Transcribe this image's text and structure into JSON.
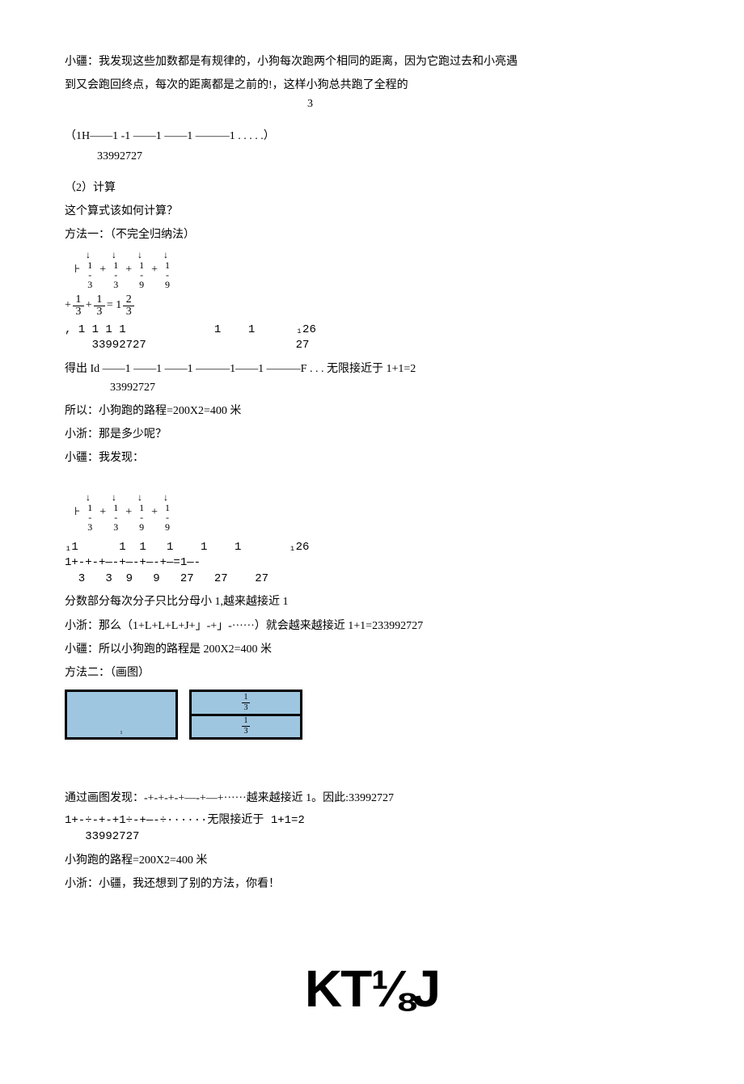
{
  "p1": "小疆：我发现这些加数都是有规律的，小狗每次跑两个相同的距离，因为它跑过去和小亮遇",
  "p2": "到又会跑回终点，每次的距离都是之前的!，这样小狗总共跑了全程的",
  "p2_under": "3",
  "p3": "（1H――1 -1 ――1 ――1 ―――1 . . . . .）",
  "p3_under": "33992727",
  "p4": "（2）计算",
  "p5": "这个算式该如何计算？",
  "p6": "方法一：（不完全归纳法）",
  "eq1_parts": [
    "1",
    "3",
    "1",
    "3",
    "1",
    "9",
    "1",
    "9"
  ],
  "eq2_prefix": "+",
  "eq2_frac1": {
    "n": "1",
    "d": "3"
  },
  "eq2_frac2": {
    "n": "1",
    "d": "3"
  },
  "eq2_mid": "= 1",
  "eq2_frac3": {
    "n": "2",
    "d": "3"
  },
  "mono1_l1": ", 1 1 1 1             1    1      ₁26",
  "mono1_l2": "    33992727                      27",
  "p7": "得出 Id ――1 ――1 ――1 ―――1――1 ―――F . . . 无限接近于 1+1=2",
  "p7_under": "33992727",
  "p8": "所以：小狗跑的路程=200X2=400 米",
  "p9": "小浙：那是多少呢？",
  "p10": "小疆：我发现：",
  "mono2_l1": "₁1      1  1   1    1    1       ₁26",
  "mono2_l2": "1+-+-+―-+―-+―-+―=1―-",
  "mono2_l3": "  3   3  9   9   27   27    27",
  "p11": "分数部分每次分子只比分母小 1,越来越接近 1",
  "p12": "小浙：那么（1+L+L+L+J+」-+」-······）就会越来越接近 1+1=233992727",
  "p13": "小疆：所以小狗跑的路程是 200X2=400 米",
  "p14": "方法二：（画图）",
  "diagram_labels": {
    "whole": "₁",
    "top": {
      "n": "1",
      "d": "3"
    },
    "bot": {
      "n": "1",
      "d": "3"
    }
  },
  "p15": "通过画图发现：-+-+-+-+―-+―+······越来越接近 1。因此:33992727",
  "p16_l1": "1+-÷-+-+1÷-+―-÷······无限接近于 1+1=2",
  "p16_l2": "   33992727",
  "p17": "小狗跑的路程=200X2=400 米",
  "p18": "小浙：小疆，我还想到了别的方法，你看！",
  "logo": "KT⅛J"
}
